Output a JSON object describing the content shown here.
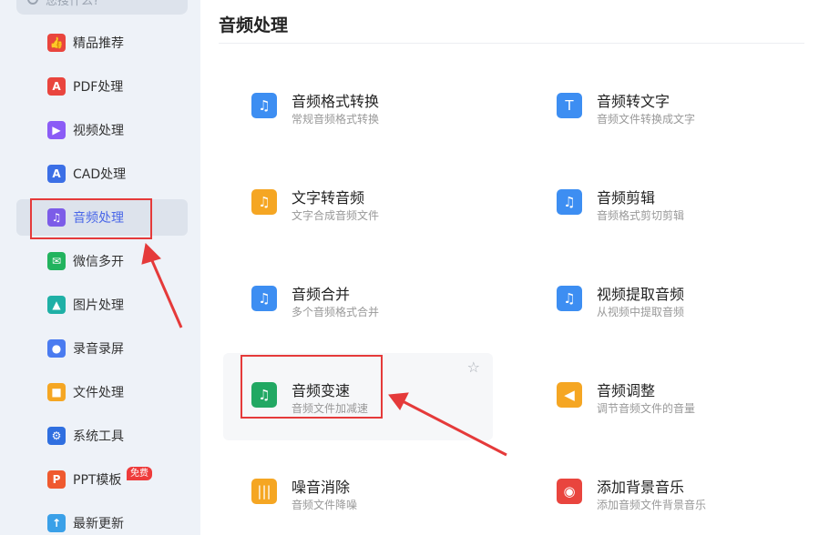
{
  "search": {
    "placeholder": "您搜什么?"
  },
  "sidebar": {
    "items": [
      {
        "label": "精品推荐",
        "color": "#e9453e",
        "glyph": "👍"
      },
      {
        "label": "PDF处理",
        "color": "#e9453e",
        "glyph": "A"
      },
      {
        "label": "视频处理",
        "color": "#8b5cf6",
        "glyph": "▶"
      },
      {
        "label": "CAD处理",
        "color": "#3b6fe6",
        "glyph": "A"
      },
      {
        "label": "音频处理",
        "color": "#7c5ce8",
        "glyph": "♫"
      },
      {
        "label": "微信多开",
        "color": "#22b35e",
        "glyph": "✉"
      },
      {
        "label": "图片处理",
        "color": "#1fb0a6",
        "glyph": "▲"
      },
      {
        "label": "录音录屏",
        "color": "#4a7bf0",
        "glyph": "●"
      },
      {
        "label": "文件处理",
        "color": "#f5a623",
        "glyph": "■"
      },
      {
        "label": "系统工具",
        "color": "#2f6fe0",
        "glyph": "⚙"
      },
      {
        "label": "PPT模板",
        "color": "#ef5a2f",
        "glyph": "P",
        "badge": "免费"
      },
      {
        "label": "最新更新",
        "color": "#3aa0e8",
        "glyph": "↑"
      }
    ],
    "active_index": 4
  },
  "main": {
    "title": "音频处理",
    "tools": [
      {
        "name": "音频格式转换",
        "desc": "常规音频格式转换",
        "color": "#3d8ef2",
        "glyph": "♫"
      },
      {
        "name": "音频转文字",
        "desc": "音频文件转换成文字",
        "color": "#3d8ef2",
        "glyph": "T"
      },
      {
        "name": "文字转音频",
        "desc": "文字合成音频文件",
        "color": "#f5a623",
        "glyph": "♫"
      },
      {
        "name": "音频剪辑",
        "desc": "音频格式剪切剪辑",
        "color": "#3d8ef2",
        "glyph": "♫"
      },
      {
        "name": "音频合并",
        "desc": "多个音频格式合并",
        "color": "#3d8ef2",
        "glyph": "♫"
      },
      {
        "name": "视频提取音频",
        "desc": "从视频中提取音频",
        "color": "#3d8ef2",
        "glyph": "♫"
      },
      {
        "name": "音频变速",
        "desc": "音频文件加减速",
        "color": "#22a863",
        "glyph": "♫"
      },
      {
        "name": "音频调整",
        "desc": "调节音频文件的音量",
        "color": "#f5a623",
        "glyph": "◀"
      },
      {
        "name": "噪音消除",
        "desc": "音频文件降噪",
        "color": "#f5a623",
        "glyph": "|||"
      },
      {
        "name": "添加背景音乐",
        "desc": "添加音频文件背景音乐",
        "color": "#e9453e",
        "glyph": "◉"
      }
    ]
  },
  "annotation_color": "#e53a3a"
}
